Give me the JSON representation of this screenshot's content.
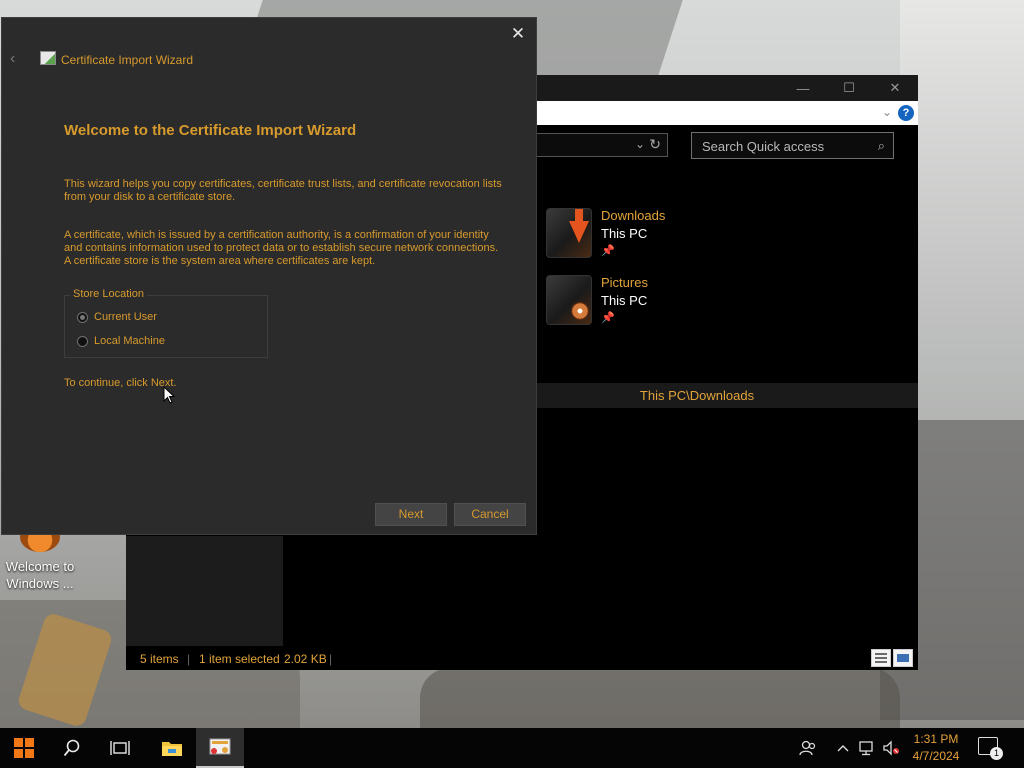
{
  "desktop": {
    "icon_label": "Welcome to Windows ..."
  },
  "explorer": {
    "search_placeholder": "Search Quick access",
    "quick_access": [
      {
        "name": "Downloads",
        "location": "This PC",
        "icon": "downloads-folder-icon"
      },
      {
        "name": "Pictures",
        "location": "This PC",
        "icon": "pictures-folder-icon"
      }
    ],
    "path_bar": "This PC\\Downloads",
    "status": {
      "items": "5 items",
      "selected": "1 item selected",
      "size": "2.02 KB"
    },
    "controls": {
      "minimize": "—",
      "maximize": "☐",
      "close": "✕"
    }
  },
  "wizard": {
    "window_title": "Certificate Import Wizard",
    "heading": "Welcome to the Certificate Import Wizard",
    "paragraph_1": "This wizard helps you copy certificates, certificate trust lists, and certificate revocation lists from your disk to a certificate store.",
    "paragraph_2": "A certificate, which is issued by a certification authority, is a confirmation of your identity and contains information used to protect data or to establish secure network connections. A certificate store is the system area where certificates are kept.",
    "store_location_label": "Store Location",
    "options": [
      {
        "label": "Current User",
        "selected": true
      },
      {
        "label": "Local Machine",
        "selected": false
      }
    ],
    "continue_text": "To continue, click Next.",
    "next_label": "Next",
    "cancel_label": "Cancel"
  },
  "taskbar": {
    "time": "1:31 PM",
    "date": "4/7/2024",
    "notification_count": "1"
  },
  "colors": {
    "accent": "#d79a2d",
    "dialog_bg": "#2b2b2b",
    "taskbar_bg": "#050505",
    "start_orange": "#f07818"
  }
}
